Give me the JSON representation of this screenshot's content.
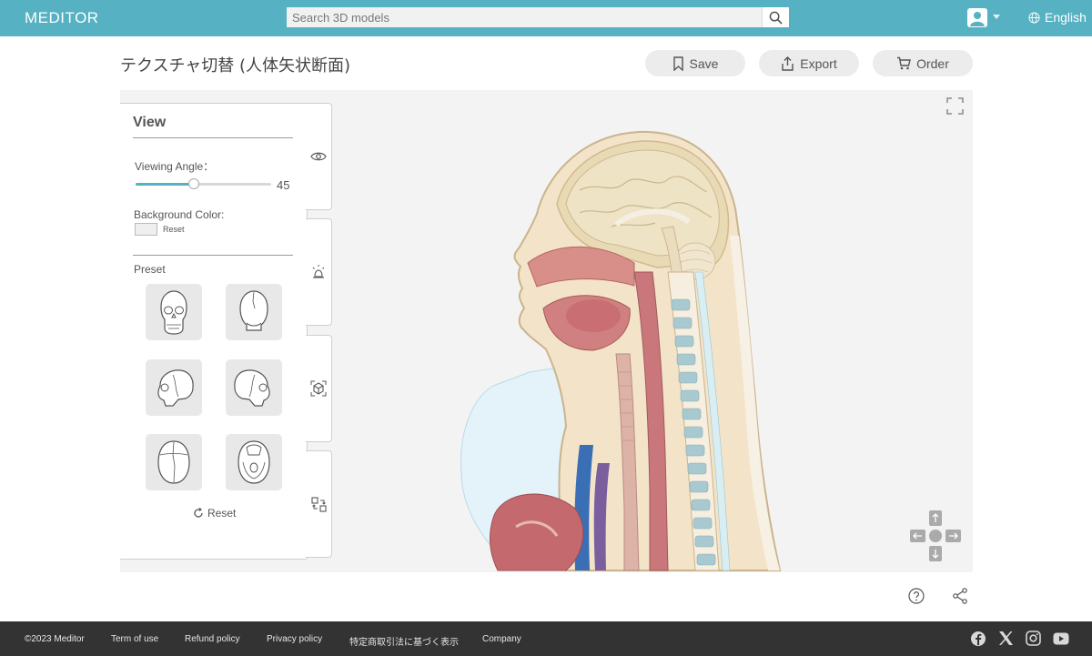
{
  "header": {
    "logo": "MEDITOR",
    "search_placeholder": "Search 3D models",
    "language": "English"
  },
  "page": {
    "title": "テクスチャ切替 (人体矢状断面)",
    "actions": {
      "save": "Save",
      "export": "Export",
      "order": "Order"
    }
  },
  "view_panel": {
    "title": "View",
    "viewing_angle_label": "Viewing Angle：",
    "viewing_angle_value": "45",
    "viewing_angle_fraction": 0.43,
    "background_color_label": "Background Color:",
    "background_reset": "Reset",
    "background_color": "#efefef",
    "preset_label": "Preset",
    "presets": [
      "skull-front",
      "skull-back",
      "skull-left",
      "skull-right",
      "skull-top",
      "skull-bottom"
    ],
    "reset_label": "Reset"
  },
  "side_tabs": [
    "eye-icon",
    "light-icon",
    "cube-icon",
    "swap-icon"
  ],
  "footer": {
    "copyright": "©2023 Meditor",
    "links": [
      "Term of use",
      "Refund policy",
      "Privacy policy",
      "特定商取引法に基づく表示",
      "Company"
    ],
    "social": [
      "facebook-icon",
      "x-icon",
      "instagram-icon",
      "youtube-icon"
    ]
  },
  "colors": {
    "accent": "#56b1c2",
    "footer": "#333333"
  }
}
